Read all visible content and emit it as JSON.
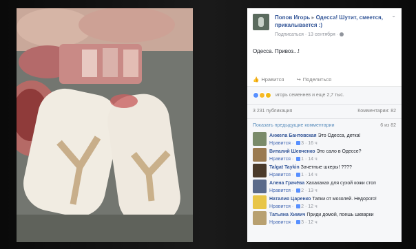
{
  "post": {
    "author": "Попов Игорь",
    "separator": "▸",
    "group": "Одесса! Шутит, смеется, прикалывается :)",
    "subline": "Подписаться · 13 сентября ·",
    "message": "Одесса. Привоз...!",
    "actions": {
      "like": "Нравится",
      "share": "Поделиться"
    },
    "reactions_text": "игорь семеннев и еще 2,7 тыс.",
    "shares": "3 231 публикация",
    "comments_count": "Комментарии: 82",
    "show_previous": "Показать предыдущие комментарии",
    "page_counter": "6 из 82"
  },
  "comments": [
    {
      "name": "Анжела Бантовская",
      "text": "Это Одесса, детка!",
      "like": "Нравится",
      "likes": "3",
      "time": "16 ч",
      "avatar_color": "#7a8b6a"
    },
    {
      "name": "Виталий Шевченко",
      "text": "Это сало в Одессе?",
      "like": "Нравится",
      "likes": "1",
      "time": "14 ч",
      "avatar_color": "#9a7a50"
    },
    {
      "name": "Talgat Taykin",
      "text": "Зачетные шкеры! ????",
      "like": "Нравится",
      "likes": "1",
      "time": "14 ч",
      "avatar_color": "#4a3a2a"
    },
    {
      "name": "Алена Грачёва",
      "text": "Хахахахах для сухой кожи стоп",
      "like": "Нравится",
      "likes": "2",
      "time": "13 ч",
      "avatar_color": "#5a6a8a"
    },
    {
      "name": "Наталия Царенко",
      "text": "Тапки от мозолей. Недорого!",
      "like": "Нравится",
      "likes": "2",
      "time": "12 ч",
      "avatar_color": "#e8c547"
    },
    {
      "name": "Татьяна Химич",
      "text": "Приди домой, поешь шкварки",
      "like": "Нравится",
      "likes": "3",
      "time": "12 ч",
      "avatar_color": "#b8a070"
    }
  ]
}
